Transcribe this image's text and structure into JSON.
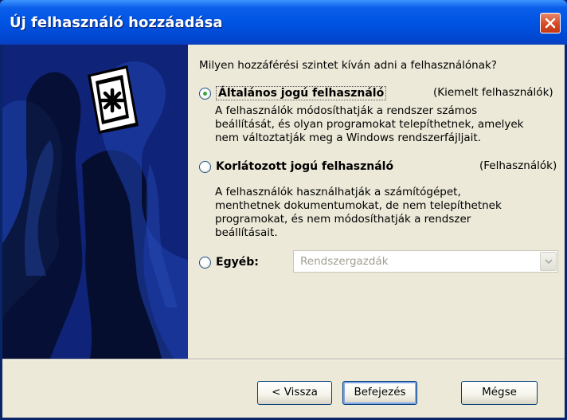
{
  "window": {
    "title": "Új felhasználó hozzáadása",
    "close_label": "✕"
  },
  "content": {
    "question": "Milyen hozzáférési szintet kíván adni a felhasználónak?",
    "options": [
      {
        "label": "Általános jogú felhasználó",
        "hint": "(Kiemelt felhasználók)",
        "checked": true,
        "description": [
          "A felhasználók módosíthatják a rendszer számos",
          "beállítását, és olyan programokat telepíthetnek, amelyek",
          "nem változtatják meg a Windows rendszerfájljait."
        ]
      },
      {
        "label": "Korlátozott jogú felhasználó",
        "hint": "(Felhasználók)",
        "checked": false,
        "description": [
          "A felhasználók használhatják a számítógépet,",
          "menthetnek dokumentumokat, de nem telepíthetnek",
          "programokat, és nem módosíthatják a rendszer",
          "beállításait."
        ]
      },
      {
        "label": "Egyéb:",
        "checked": false,
        "select_value": "Rendszergazdák"
      }
    ]
  },
  "buttons": {
    "back": "< Vissza",
    "finish": "Befejezés",
    "cancel": "Mégse"
  },
  "colors": {
    "titlebar": "#0054e3",
    "side_panel": "#0f2378",
    "dialog_bg": "#ece9d8"
  },
  "icons": {
    "close": "close-icon",
    "keys": "keys-icon",
    "dropdown": "chevron-down-icon"
  }
}
